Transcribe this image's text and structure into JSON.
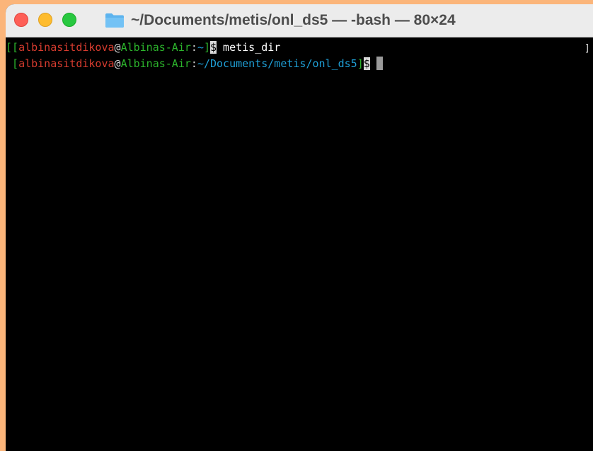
{
  "window": {
    "title": "~/Documents/metis/onl_ds5 — -bash — 80×24",
    "folder_icon": "folder-icon",
    "background": "#fbb57a"
  },
  "terminal": {
    "lines": [
      {
        "open": "[[",
        "user": "albinasitdikova",
        "at": "@",
        "host": "Albinas-Air",
        "colon": ":",
        "path": "~",
        "close": "]",
        "dollar": "$",
        "command": " metis_dir"
      },
      {
        "open": " [",
        "user": "albinasitdikova",
        "at": "@",
        "host": "Albinas-Air",
        "colon": ":",
        "path": "~/Documents/metis/onl_ds5",
        "close": "]",
        "dollar": "$",
        "command": " "
      }
    ],
    "edge_mark": "]"
  }
}
